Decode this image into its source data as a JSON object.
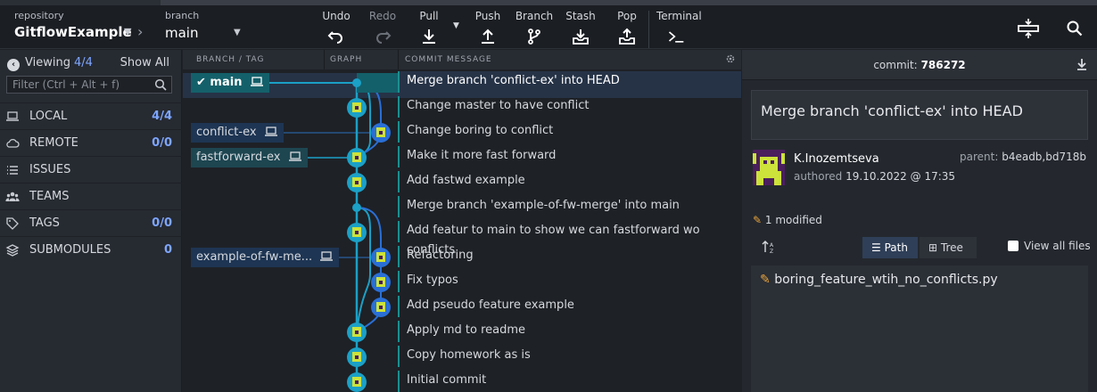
{
  "toolbar": {
    "repo_label": "repository",
    "repo_name": "GitflowExample",
    "branch_label": "branch",
    "branch_name": "main",
    "buttons": {
      "undo": "Undo",
      "redo": "Redo",
      "pull": "Pull",
      "push": "Push",
      "branch": "Branch",
      "stash": "Stash",
      "pop": "Pop",
      "terminal": "Terminal"
    }
  },
  "sidebar": {
    "viewing_label": "Viewing",
    "viewing_count": "4/4",
    "show_all": "Show All",
    "filter_placeholder": "Filter (Ctrl + Alt + f)",
    "items": [
      {
        "label": "LOCAL",
        "count": "4/4",
        "icon": "laptop-icon"
      },
      {
        "label": "REMOTE",
        "count": "0/0",
        "icon": "cloud-icon"
      },
      {
        "label": "ISSUES",
        "count": "",
        "icon": "list-icon"
      },
      {
        "label": "TEAMS",
        "count": "",
        "icon": "people-icon"
      },
      {
        "label": "TAGS",
        "count": "0/0",
        "icon": "tag-icon"
      },
      {
        "label": "SUBMODULES",
        "count": "0",
        "icon": "layers-icon"
      }
    ]
  },
  "graph": {
    "headers": {
      "branch_tag": "BRANCH / TAG",
      "graph": "GRAPH",
      "commit_message": "COMMIT MESSAGE"
    },
    "tags": {
      "main": "main",
      "conflict_ex": "conflict-ex",
      "fastforward_ex": "fastforward-ex",
      "example_of_fw": "example-of-fw-me..."
    },
    "commits": [
      "Merge branch 'conflict-ex' into HEAD",
      "Change master to have conflict",
      "Change boring to conflict",
      "Make it more fast forward",
      "Add fastwd example",
      "Merge branch 'example-of-fw-merge' into main",
      "Add featur to main to show we can fastforward wo conflicts",
      "Refactoring",
      "Fix typos",
      "Add pseudo feature example",
      "Apply md to readme",
      "Copy homework as is",
      "Initial commit"
    ]
  },
  "detail": {
    "commit_label": "commit:",
    "commit_sha": "786272",
    "summary": "Merge branch 'conflict-ex' into HEAD",
    "author": "K.Inozemtseva",
    "authored_label": "authored",
    "authored_date": "19.10.2022 @ 17:35",
    "parent_label": "parent:",
    "parent_value": "b4eadb,bd718b",
    "modified": "1 modified",
    "path_label": "Path",
    "tree_label": "Tree",
    "view_all_label": "View all files",
    "files": [
      "boring_feature_wtih_no_conflicts.py"
    ]
  },
  "colors": {
    "accent_blue": "#7ea6ff",
    "graph_main": "#1ba0c6",
    "graph_blue": "#2a6fd6",
    "selected_row": "#263347"
  }
}
